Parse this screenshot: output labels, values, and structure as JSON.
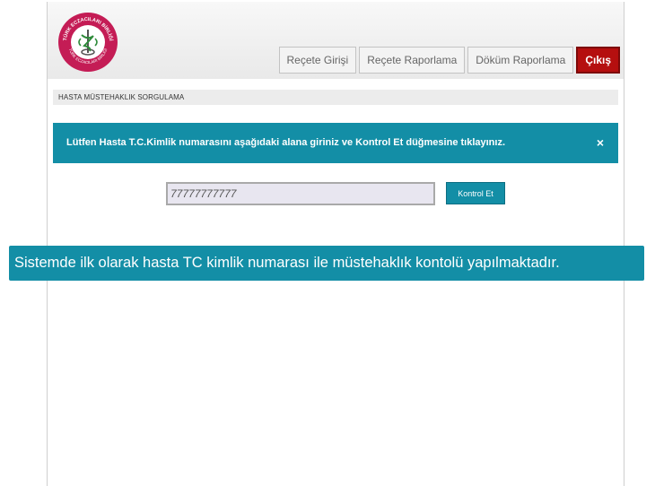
{
  "logo": {
    "top_text": "TÜRK ECZACILARI BİRLİĞİ",
    "bottom_text": "TÜRK ECZACILARI BİRLİĞİ"
  },
  "nav": {
    "items": [
      "Reçete Girişi",
      "Reçete Raporlama",
      "Döküm Raporlama"
    ],
    "exit_label": "Çıkış"
  },
  "section": {
    "title": "HASTA MÜSTEHAKLIK SORGULAMA"
  },
  "info": {
    "message": "Lütfen Hasta T.C.Kimlik numarasını aşağıdaki alana giriniz ve Kontrol Et düğmesine tıklayınız.",
    "close_glyph": "×"
  },
  "form": {
    "tc_value": "77777777777",
    "submit_label": "Kontrol Et"
  },
  "caption": {
    "text": "Sistemde ilk olarak hasta TC kimlik numarası ile müstehaklık kontolü yapılmaktadır."
  },
  "colors": {
    "accent": "#138ea6",
    "exit": "#b50f0f",
    "logo": "#c41c55"
  }
}
